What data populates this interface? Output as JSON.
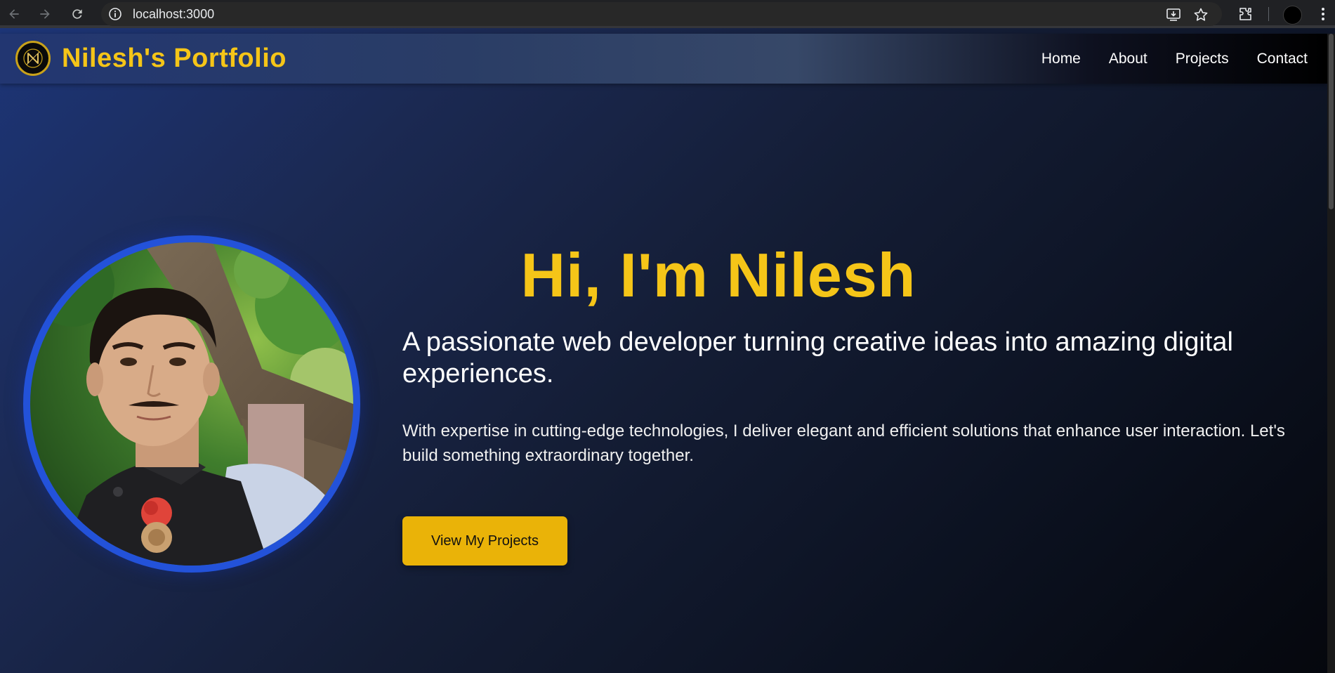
{
  "browser": {
    "url": "localhost:3000",
    "icons": [
      "back-arrow-icon",
      "forward-arrow-icon",
      "reload-icon",
      "site-info-icon",
      "install-app-icon",
      "star-icon",
      "extensions-icon",
      "profile-avatar",
      "more-menu-icon"
    ]
  },
  "header": {
    "title": "Nilesh's Portfolio",
    "nav": [
      "Home",
      "About",
      "Projects",
      "Contact"
    ]
  },
  "hero": {
    "heading": "Hi, I'm Nilesh",
    "tagline": "A passionate web developer turning creative ideas into amazing digital experiences.",
    "description": "With expertise in cutting-edge technologies, I deliver elegant and efficient solutions that enhance user interaction. Let's build something extraordinary together.",
    "cta": "View My Projects"
  },
  "colors": {
    "accent": "#f5c518",
    "button": "#eab308",
    "ring": "#2352d9"
  }
}
